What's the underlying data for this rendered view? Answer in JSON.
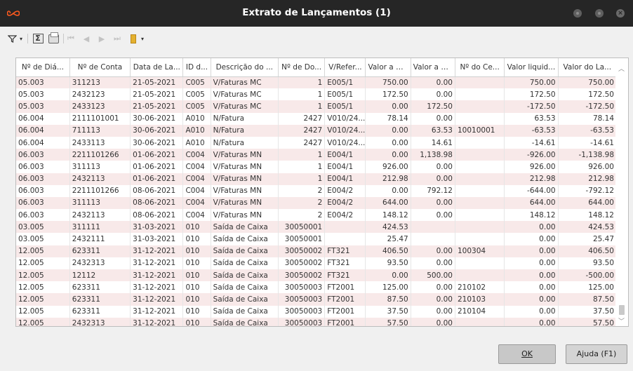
{
  "window": {
    "title": "Extrato de Lançamentos (1)",
    "logo_icon": "infinity-icon",
    "accent": "#ff5a1f"
  },
  "toolbar": {
    "filter_label": "≈",
    "caret": "▾",
    "sigma": "Σ"
  },
  "grid": {
    "columns": [
      "Nº de Diá...",
      "Nº de Conta",
      "Data de La...",
      "ID d...",
      "Descrição do ...",
      "Nº de Do...",
      "V/Refer...",
      "Valor a D...",
      "Valor a Cr...",
      "Nº do Ce...",
      "Valor liquid...",
      "Valor do La..."
    ],
    "rows": [
      [
        "05.003",
        "311213",
        "21-05-2021",
        "C005",
        "V/Faturas MC",
        "1",
        "E005/1",
        "750.00",
        "0.00",
        "",
        "750.00",
        "750.00"
      ],
      [
        "05.003",
        "2432123",
        "21-05-2021",
        "C005",
        "V/Faturas MC",
        "1",
        "E005/1",
        "172.50",
        "0.00",
        "",
        "172.50",
        "172.50"
      ],
      [
        "05.003",
        "2433123",
        "21-05-2021",
        "C005",
        "V/Faturas MC",
        "1",
        "E005/1",
        "0.00",
        "172.50",
        "",
        "-172.50",
        "-172.50"
      ],
      [
        "06.004",
        "2111101001",
        "30-06-2021",
        "A010",
        "N/Fatura",
        "2427",
        "V010/24...",
        "78.14",
        "0.00",
        "",
        "63.53",
        "78.14"
      ],
      [
        "06.004",
        "711113",
        "30-06-2021",
        "A010",
        "N/Fatura",
        "2427",
        "V010/24...",
        "0.00",
        "63.53",
        "10010001",
        "-63.53",
        "-63.53"
      ],
      [
        "06.004",
        "2433113",
        "30-06-2021",
        "A010",
        "N/Fatura",
        "2427",
        "V010/24...",
        "0.00",
        "14.61",
        "",
        "-14.61",
        "-14.61"
      ],
      [
        "06.003",
        "2211101266",
        "01-06-2021",
        "C004",
        "V/Faturas MN",
        "1",
        "E004/1",
        "0.00",
        "1,138.98",
        "",
        "-926.00",
        "-1,138.98"
      ],
      [
        "06.003",
        "311113",
        "01-06-2021",
        "C004",
        "V/Faturas MN",
        "1",
        "E004/1",
        "926.00",
        "0.00",
        "",
        "926.00",
        "926.00"
      ],
      [
        "06.003",
        "2432113",
        "01-06-2021",
        "C004",
        "V/Faturas MN",
        "1",
        "E004/1",
        "212.98",
        "0.00",
        "",
        "212.98",
        "212.98"
      ],
      [
        "06.003",
        "2211101266",
        "08-06-2021",
        "C004",
        "V/Faturas MN",
        "2",
        "E004/2",
        "0.00",
        "792.12",
        "",
        "-644.00",
        "-792.12"
      ],
      [
        "06.003",
        "311113",
        "08-06-2021",
        "C004",
        "V/Faturas MN",
        "2",
        "E004/2",
        "644.00",
        "0.00",
        "",
        "644.00",
        "644.00"
      ],
      [
        "06.003",
        "2432113",
        "08-06-2021",
        "C004",
        "V/Faturas MN",
        "2",
        "E004/2",
        "148.12",
        "0.00",
        "",
        "148.12",
        "148.12"
      ],
      [
        "03.005",
        "311111",
        "31-03-2021",
        "010",
        "Saída de Caixa",
        "30050001",
        "",
        "424.53",
        "",
        "",
        "0.00",
        "424.53"
      ],
      [
        "03.005",
        "2432111",
        "31-03-2021",
        "010",
        "Saída de Caixa",
        "30050001",
        "",
        "25.47",
        "",
        "",
        "0.00",
        "25.47"
      ],
      [
        "12.005",
        "623311",
        "31-12-2021",
        "010",
        "Saída de Caixa",
        "30050002",
        "FT321",
        "406.50",
        "0.00",
        "100304",
        "0.00",
        "406.50"
      ],
      [
        "12.005",
        "2432313",
        "31-12-2021",
        "010",
        "Saída de Caixa",
        "30050002",
        "FT321",
        "93.50",
        "0.00",
        "",
        "0.00",
        "93.50"
      ],
      [
        "12.005",
        "12112",
        "31-12-2021",
        "010",
        "Saída de Caixa",
        "30050002",
        "FT321",
        "0.00",
        "500.00",
        "",
        "0.00",
        "-500.00"
      ],
      [
        "12.005",
        "623311",
        "31-12-2021",
        "010",
        "Saída de Caixa",
        "30050003",
        "FT2001",
        "125.00",
        "0.00",
        "210102",
        "0.00",
        "125.00"
      ],
      [
        "12.005",
        "623311",
        "31-12-2021",
        "010",
        "Saída de Caixa",
        "30050003",
        "FT2001",
        "87.50",
        "0.00",
        "210103",
        "0.00",
        "87.50"
      ],
      [
        "12.005",
        "623311",
        "31-12-2021",
        "010",
        "Saída de Caixa",
        "30050003",
        "FT2001",
        "37.50",
        "0.00",
        "210104",
        "0.00",
        "37.50"
      ],
      [
        "12.005",
        "2432313",
        "31-12-2021",
        "010",
        "Saída de Caixa",
        "30050003",
        "FT2001",
        "57.50",
        "0.00",
        "",
        "0.00",
        "57.50"
      ]
    ]
  },
  "footer": {
    "ok_label": "OK",
    "help_label": "Ajuda (F1)"
  }
}
